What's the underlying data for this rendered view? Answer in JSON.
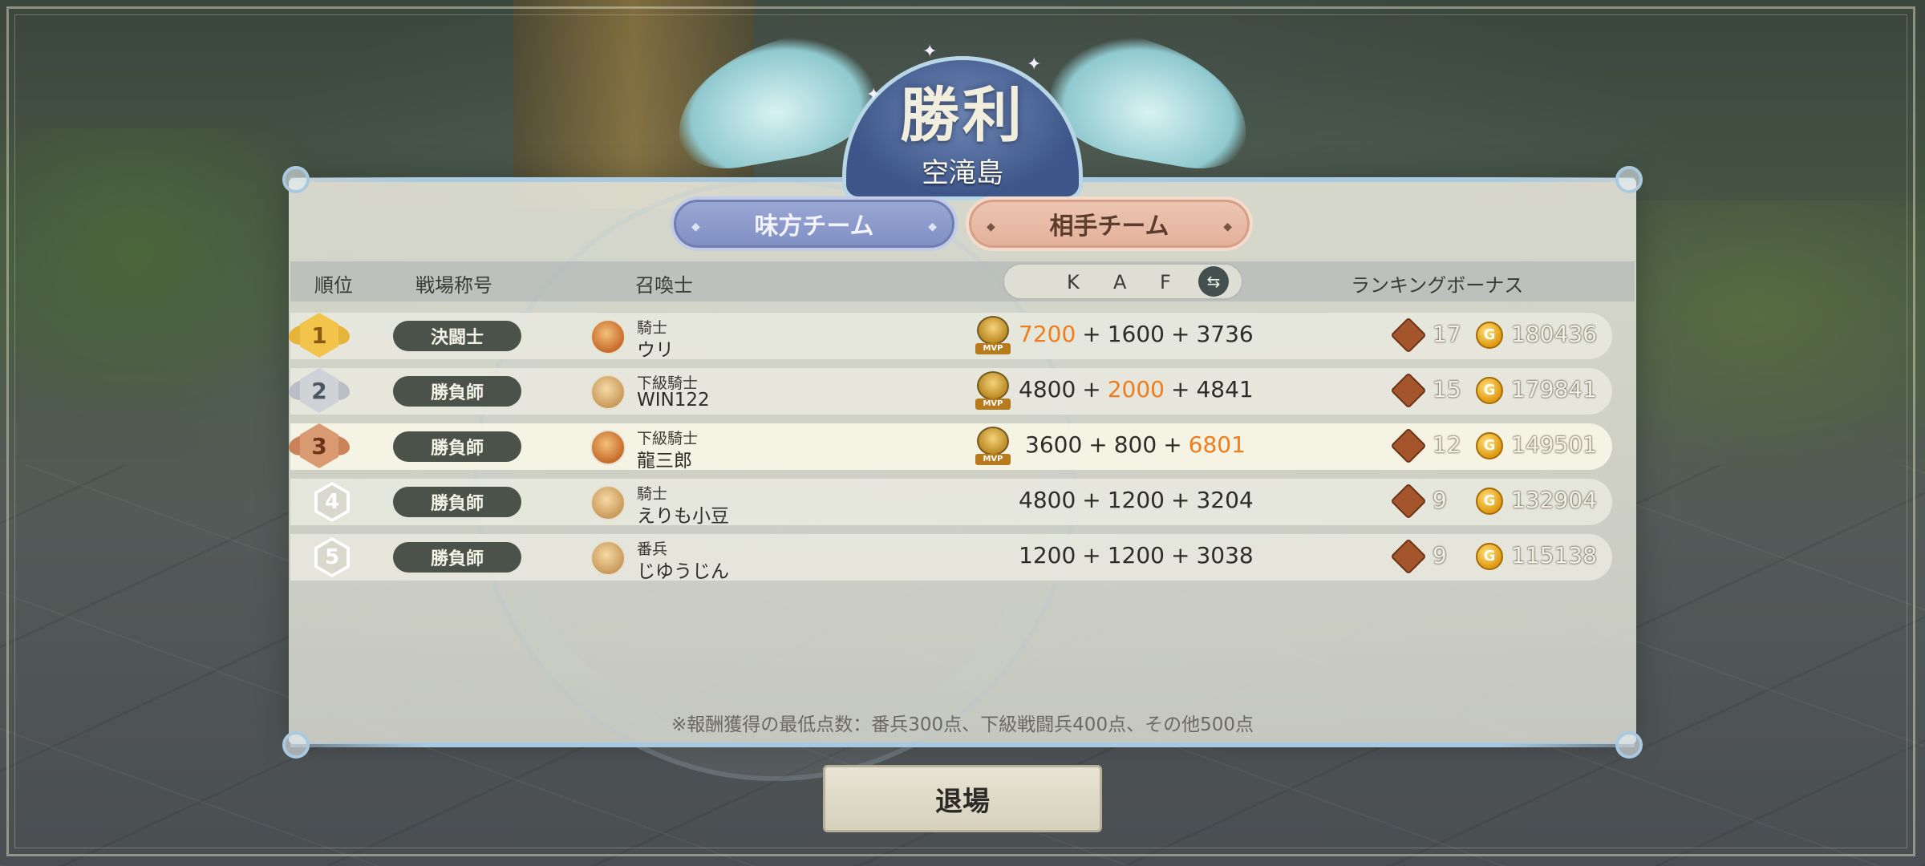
{
  "header": {
    "title": "勝利",
    "map_name": "空滝島"
  },
  "tabs": [
    {
      "label": "味方チーム",
      "state": "inactive",
      "color": "#8493c8"
    },
    {
      "label": "相手チーム",
      "state": "active",
      "color": "#e7b7a2"
    }
  ],
  "columns": {
    "rank": "順位",
    "title": "戦場称号",
    "summoner": "召喚士",
    "k": "K",
    "a": "A",
    "f": "F",
    "bonus": "ランキングボーナス",
    "swap_icon": "swap-icon"
  },
  "rows": [
    {
      "rank": "1",
      "title": "決闘士",
      "rank_name": "騎士",
      "player": "ウリ",
      "mvp": true,
      "k": "7200",
      "a": "1600",
      "f": "3736",
      "highlight": "k",
      "tickets": "17",
      "coins": "180436"
    },
    {
      "rank": "2",
      "title": "勝負師",
      "rank_name": "下級騎士",
      "player": "WIN122",
      "mvp": true,
      "k": "4800",
      "a": "2000",
      "f": "4841",
      "highlight": "a",
      "tickets": "15",
      "coins": "179841"
    },
    {
      "rank": "3",
      "title": "勝負師",
      "rank_name": "下級騎士",
      "player": "龍三郎",
      "mvp": true,
      "k": "3600",
      "a": "800",
      "f": "6801",
      "highlight": "f",
      "tickets": "12",
      "coins": "149501"
    },
    {
      "rank": "4",
      "title": "勝負師",
      "rank_name": "騎士",
      "player": "えりも小豆",
      "mvp": false,
      "k": "4800",
      "a": "1200",
      "f": "3204",
      "highlight": "",
      "tickets": "9",
      "coins": "132904"
    },
    {
      "rank": "5",
      "title": "勝負師",
      "rank_name": "番兵",
      "player": "じゆうじん",
      "mvp": false,
      "k": "1200",
      "a": "1200",
      "f": "3038",
      "highlight": "",
      "tickets": "9",
      "coins": "115138"
    }
  ],
  "mvp_label": "MVP",
  "coin_symbol": "G",
  "note": "※報酬獲得の最低点数：番兵300点、下級戦闘兵400点、その他500点",
  "exit_button": "退場",
  "colors": {
    "highlight": "#ef7d1e",
    "title_pill": "#4a5249",
    "gold_medal": "#e7b43a",
    "silver_medal": "#b9bec6",
    "bronze_medal": "#c9825a"
  }
}
